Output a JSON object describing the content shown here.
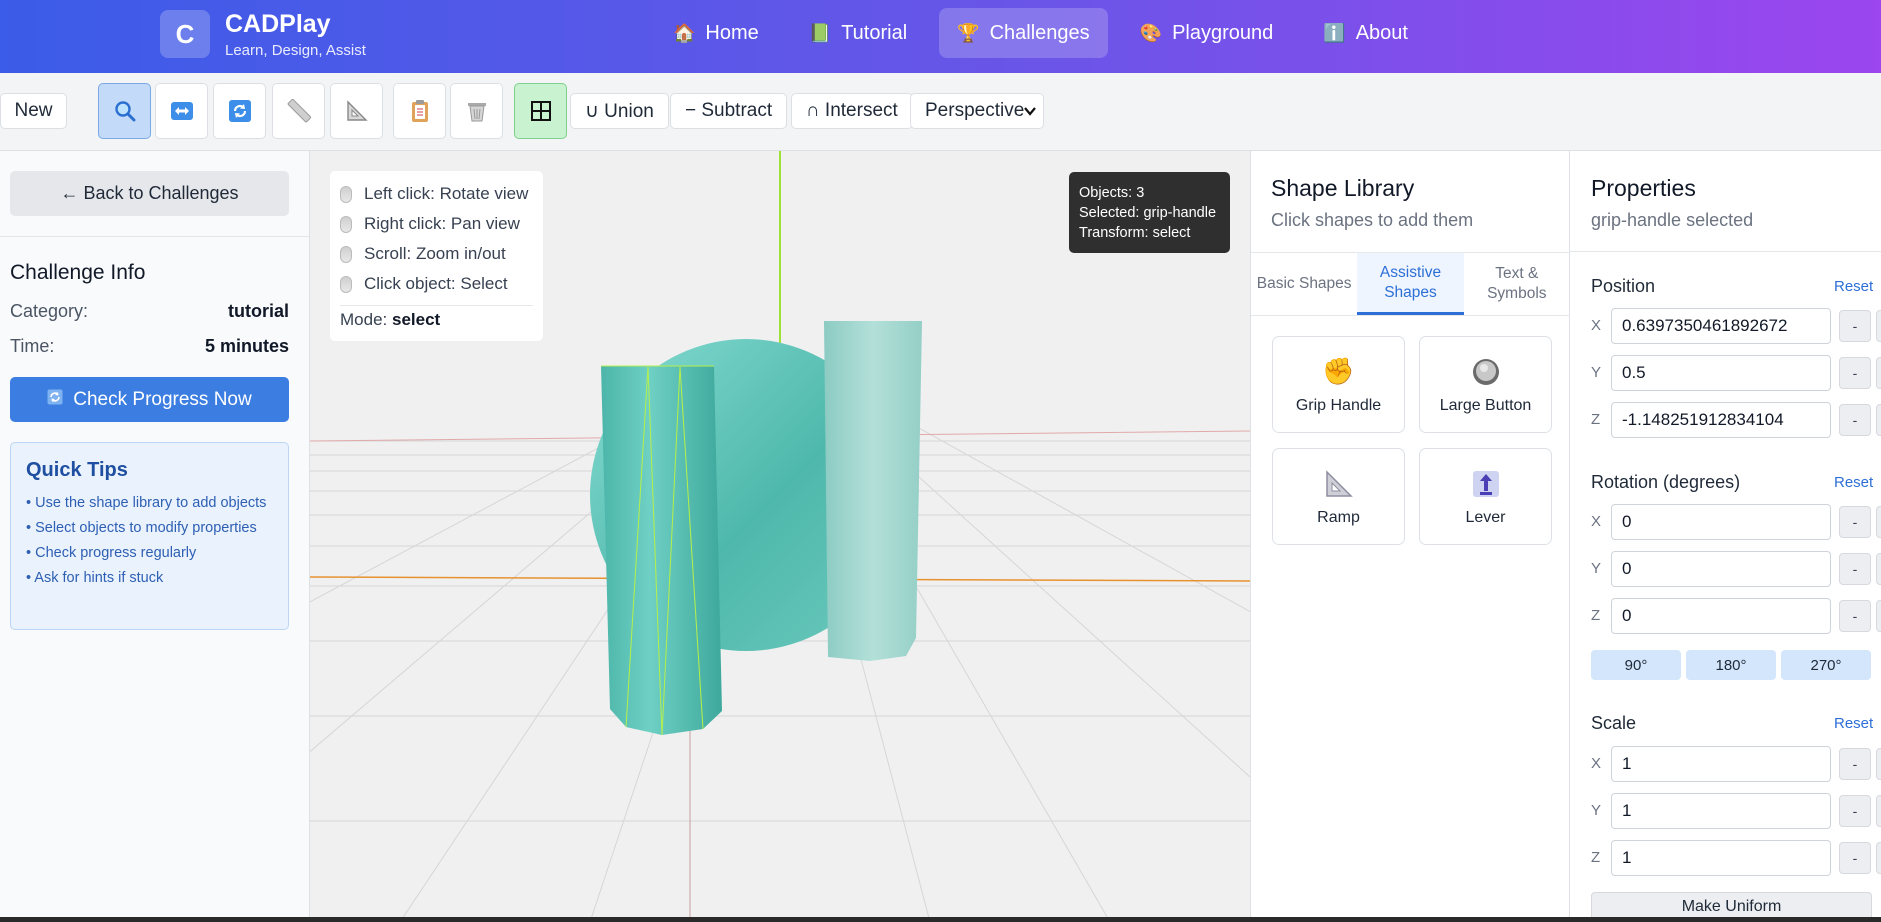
{
  "header": {
    "logo_letter": "C",
    "brand": "CADPlay",
    "tagline": "Learn, Design, Assist",
    "nav": [
      {
        "label": "Home",
        "icon": "🏠"
      },
      {
        "label": "Tutorial",
        "icon": "📗"
      },
      {
        "label": "Challenges",
        "icon": "🏆"
      },
      {
        "label": "Playground",
        "icon": "🎨"
      },
      {
        "label": "About",
        "icon": "ℹ️"
      }
    ],
    "active_nav": "Challenges"
  },
  "toolbar": {
    "new_label": "New",
    "union_label": "∪ Union",
    "subtract_label": "− Subtract",
    "intersect_label": "∩ Intersect",
    "view_mode": "Perspective",
    "tool_icons": [
      "search-icon",
      "move-icon",
      "rotate-icon",
      "ruler-icon",
      "triangle-ruler-icon",
      "clipboard-icon",
      "trash-icon",
      "grid-icon"
    ]
  },
  "left": {
    "back_label": "← Back to Challenges",
    "info_title": "Challenge Info",
    "category_key": "Category:",
    "category_value": "tutorial",
    "time_key": "Time:",
    "time_value": "5 minutes",
    "check_label": "Check Progress Now",
    "tips_title": "Quick Tips",
    "tips": [
      "• Use the shape library to add objects",
      "• Select objects to modify properties",
      "• Check progress regularly",
      "• Ask for hints if stuck"
    ]
  },
  "viewport": {
    "help": [
      "Left click: Rotate view",
      "Right click: Pan view",
      "Scroll: Zoom in/out",
      "Click object: Select"
    ],
    "mode_key": "Mode:",
    "mode_value": "select",
    "info_objects": "Objects: 3",
    "info_selected": "Selected: grip-handle",
    "info_transform": "Transform: select",
    "colors": {
      "teal": "#5fc6bb",
      "pale_teal": "#a9d9d1",
      "grid": "#d4d4d6"
    }
  },
  "library": {
    "title": "Shape Library",
    "subtitle": "Click shapes to add them",
    "tabs": [
      "Basic Shapes",
      "Assistive Shapes",
      "Text & Symbols"
    ],
    "active_tab": "Assistive Shapes",
    "shapes": [
      {
        "label": "Grip Handle",
        "icon": "✊"
      },
      {
        "label": "Large Button",
        "icon": "⚪"
      },
      {
        "label": "Ramp",
        "icon": "📐"
      },
      {
        "label": "Lever",
        "icon": "🕹"
      }
    ]
  },
  "properties": {
    "title": "Properties",
    "subtitle": "grip-handle selected",
    "position_title": "Position",
    "rotation_title": "Rotation (degrees)",
    "scale_title": "Scale",
    "reset_label": "Reset",
    "position": {
      "x": "0.6397350461892672",
      "y": "0.5",
      "z": "-1.148251912834104"
    },
    "rotation": {
      "x": "0",
      "y": "0",
      "z": "0"
    },
    "scale": {
      "x": "1",
      "y": "1",
      "z": "1"
    },
    "axes": [
      "X",
      "Y",
      "Z"
    ],
    "minus_label": "-",
    "rotation_presets": [
      "90°",
      "180°",
      "270°"
    ],
    "uniform_label": "Make Uniform"
  }
}
